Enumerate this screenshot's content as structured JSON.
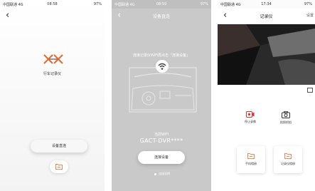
{
  "screen1": {
    "status": {
      "carrier": "中国联通 4G",
      "time": "08:58",
      "battery": "97%"
    },
    "logo_label": "行车记录仪",
    "connect_button": "设备直连"
  },
  "screen2": {
    "status": {
      "carrier": "中国联通 4G",
      "time": "08:59",
      "battery": "97%"
    },
    "title": "设备直连",
    "hint": "连接记录仪WiFi再点击「连接设备」",
    "current_wifi_label": "当前WiFi",
    "ssid": "GACT-DVR****",
    "connect_button": "连接设备",
    "footnote": "连接说明"
  },
  "screen3": {
    "status": {
      "carrier": "中国联通 4G",
      "time": "17:34",
      "battery": "97%"
    },
    "title": "记录仪",
    "right_label": "设置",
    "stop_record": "停止录像",
    "capture": "拍照抓拍",
    "phone_album": "手机相册",
    "recorder_album": "记录仪相册"
  },
  "colors": {
    "accent": "#e8692a",
    "record_red": "#d9342b",
    "grey_bg": "#c9c9c9"
  }
}
